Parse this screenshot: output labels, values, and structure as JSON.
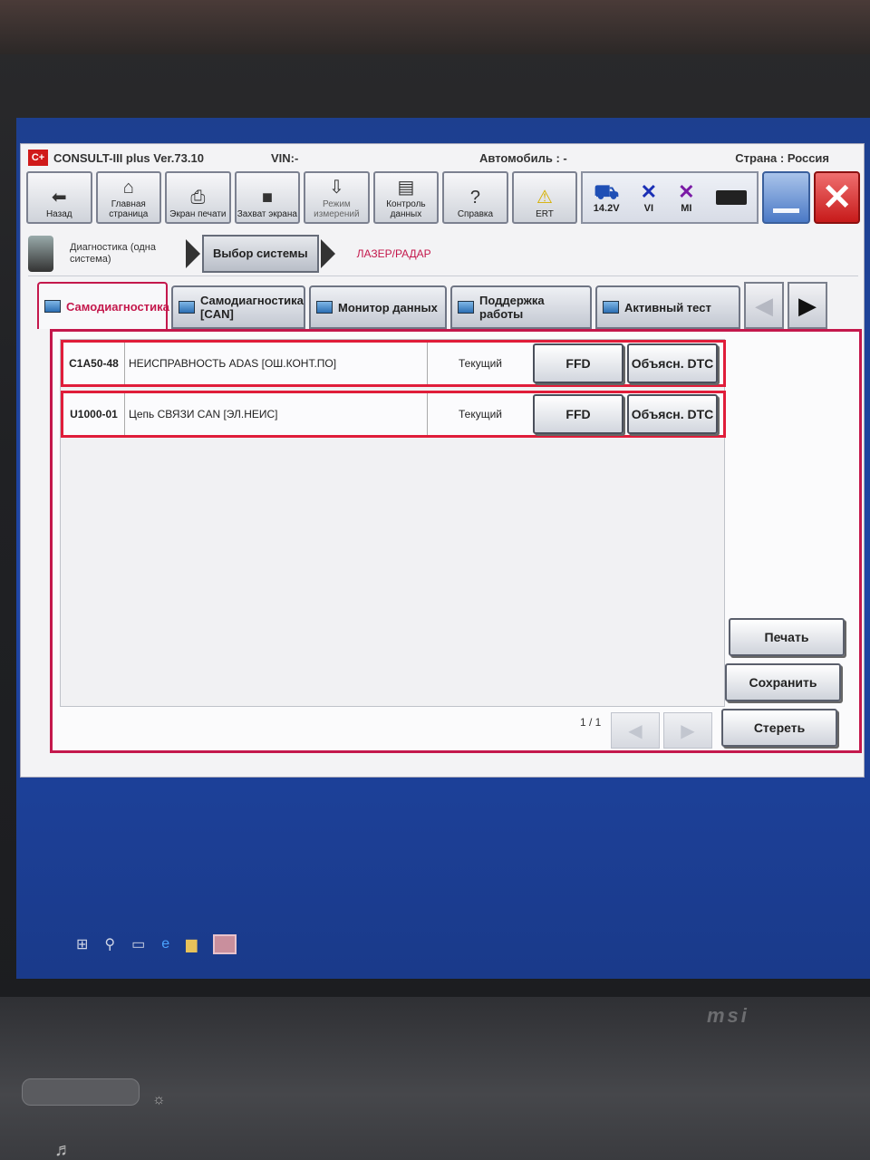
{
  "app": {
    "title": "CONSULT-III plus  Ver.73.10",
    "logo": "C+",
    "vin": "VIN:-",
    "vehicle": "Автомобиль : -",
    "country": "Страна : Россия"
  },
  "toolbar": {
    "back": "Назад",
    "home": "Главная страница",
    "print_screen": "Экран печати",
    "capture": "Захват экрана",
    "measure_mode": "Режим измерений",
    "data_control": "Контроль данных",
    "help": "Справка",
    "ert": "ERT",
    "voltage": "14.2V",
    "vi": "VI",
    "mi": "MI"
  },
  "breadcrumb": {
    "step1": "Диагностика (одна система)",
    "step2": "Выбор системы",
    "current": "ЛАЗЕР/РАДАР"
  },
  "tabs": [
    {
      "label": "Самодиагностика"
    },
    {
      "label": "Самодиагностика [CAN]"
    },
    {
      "label": "Монитор данных"
    },
    {
      "label": "Поддержка работы"
    },
    {
      "label": "Активный тест"
    }
  ],
  "dtc_rows": [
    {
      "code": "C1A50-48",
      "description": "НЕИСПРАВНОСТЬ ADAS [ОШ.КОНТ.ПО]",
      "status": "Текущий",
      "ffd": "FFD",
      "explain": "Объясн. DTC"
    },
    {
      "code": "U1000-01",
      "description": "Цепь СВЯЗИ CAN [ЭЛ.НЕИС]",
      "status": "Текущий",
      "ffd": "FFD",
      "explain": "Объясн. DTC"
    }
  ],
  "pagination": {
    "text": "1 / 1"
  },
  "actions": {
    "print": "Печать",
    "save": "Сохранить",
    "erase": "Стереть"
  },
  "laptop": {
    "brand": "msi"
  }
}
